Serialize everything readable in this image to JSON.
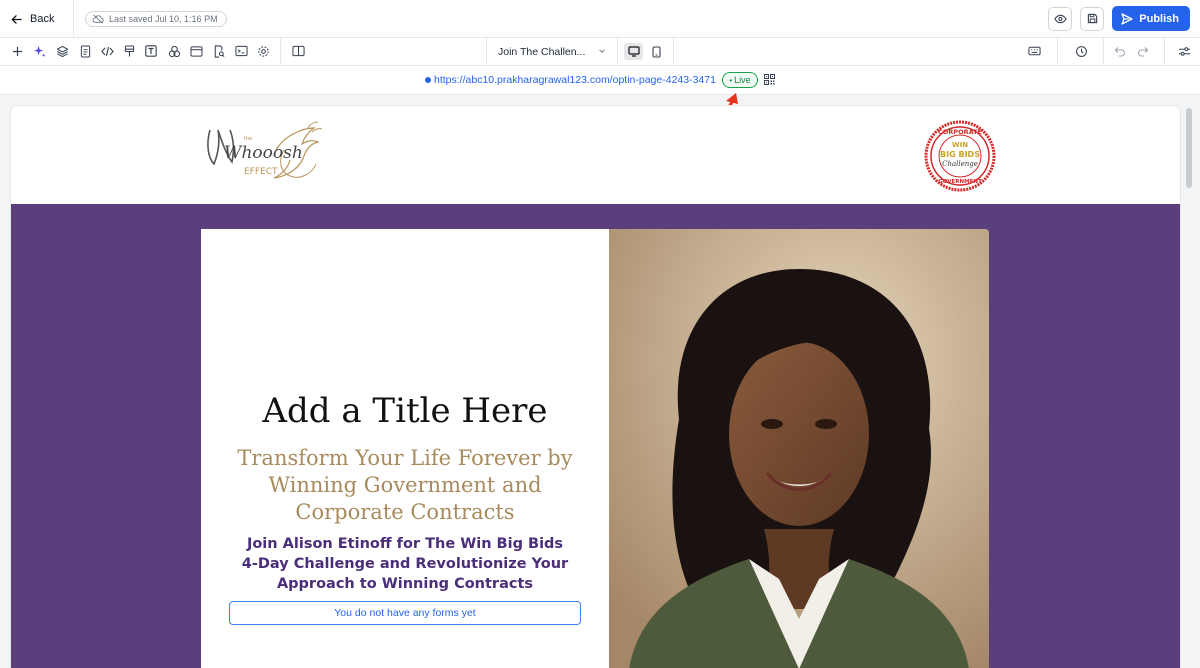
{
  "topbar": {
    "back_label": "Back",
    "last_saved": "Last saved Jul 10, 1:16 PM",
    "publish_label": "Publish"
  },
  "toolbar": {
    "page_name": "Join The Challen...",
    "tools": [
      "add-icon",
      "sparkle-icon",
      "layers-icon",
      "page-icon",
      "code-icon",
      "paint-icon",
      "text-icon",
      "shapes-icon",
      "layout-icon",
      "file-search-icon",
      "terminal-icon",
      "settings-cog-icon",
      "columns-icon"
    ]
  },
  "urlbar": {
    "url": "https://abc10.prakharagrawal123.com/optin-page-4243-3471",
    "status": "Live"
  },
  "page": {
    "logo_left": {
      "line1": "the",
      "line2": "Whooosh",
      "line3": "EFFECT"
    },
    "logo_right": {
      "top": "CORPORATE",
      "middle1": "WIN",
      "middle2": "BIG BIDS",
      "middle3": "Challenge",
      "bottom": "GOVERNMENT"
    },
    "title": "Add a Title Here",
    "subtitle": "Transform Your Life Forever by Winning Government and Corporate Contracts",
    "description": "Join Alison Etinoff for The Win Big Bids 4-Day Challenge and Revolutionize Your Approach to Winning Contracts",
    "forms_placeholder": "You do not have any forms yet"
  },
  "colors": {
    "accent": "#2563eb",
    "hero_bg": "#5b3f7d",
    "subtitle": "#a88a5c",
    "description": "#4b2e7a",
    "live": "#15803d"
  }
}
